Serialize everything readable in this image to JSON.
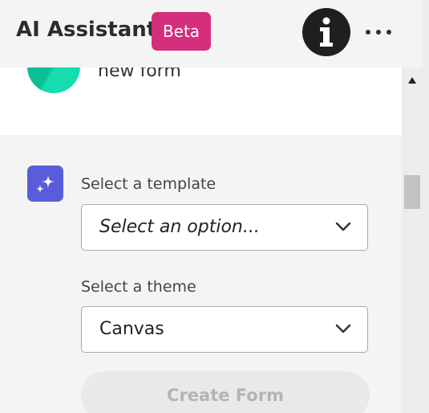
{
  "header": {
    "title": "AI Assistant",
    "badge": "Beta"
  },
  "message": {
    "text": "new form"
  },
  "template_field": {
    "label": "Select a template",
    "value": "Select an option..."
  },
  "theme_field": {
    "label": "Select a theme",
    "value": "Canvas"
  },
  "create_button": {
    "label": "Create Form",
    "enabled": false
  },
  "icons": {
    "info": "info-icon",
    "more": "more-horizontal-icon",
    "sparkle": "sparkle-icon",
    "chevron": "chevron-down-icon"
  },
  "colors": {
    "badge": "#d42e7c",
    "sparkle_bg": "#5a5ddb",
    "avatar": "#0bbf95"
  }
}
